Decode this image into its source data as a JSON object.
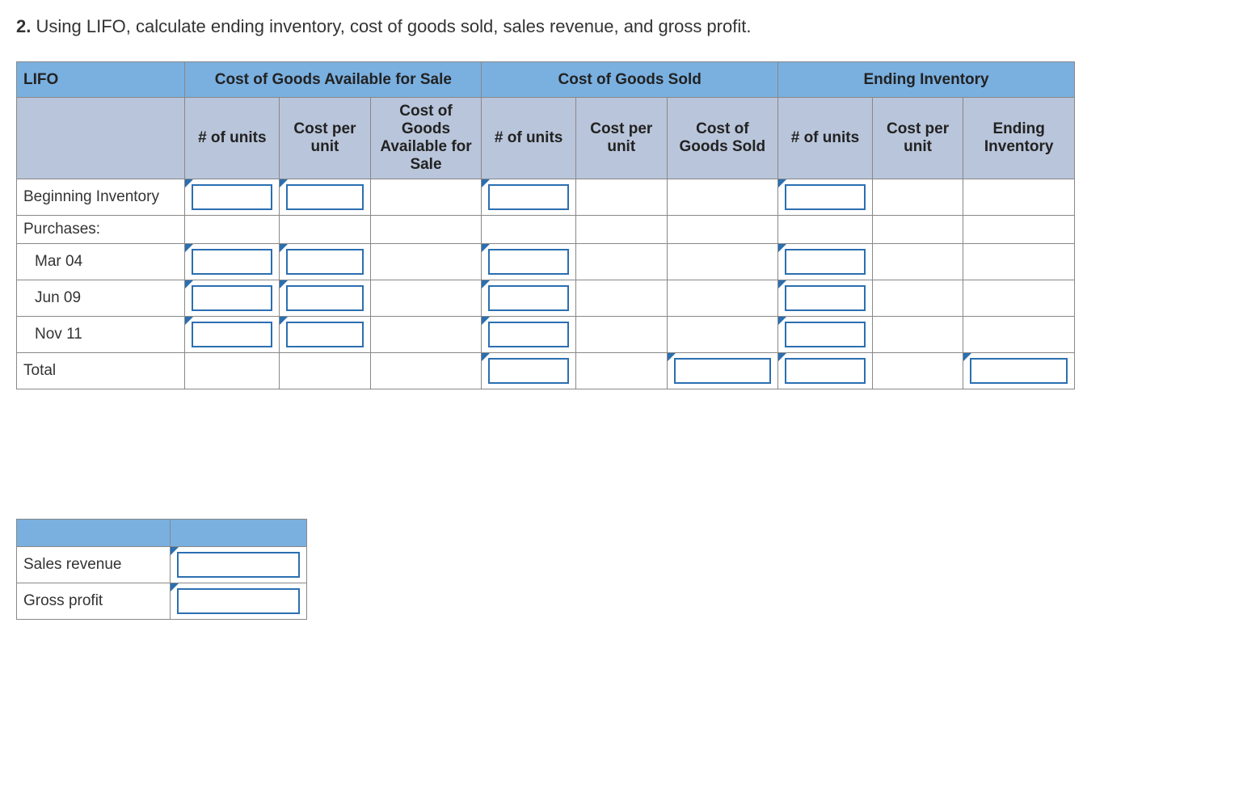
{
  "question": {
    "number": "2.",
    "text": "Using LIFO, calculate ending inventory, cost of goods sold, sales revenue, and gross profit."
  },
  "table": {
    "top_left": "LIFO",
    "group_headers": [
      "Cost of Goods Available for Sale",
      "Cost of Goods Sold",
      "Ending Inventory"
    ],
    "sub_headers": {
      "avail": [
        "# of units",
        "Cost per unit",
        "Cost of Goods Available for Sale"
      ],
      "sold": [
        "# of units",
        "Cost per unit",
        "Cost of Goods Sold"
      ],
      "ending": [
        "# of units",
        "Cost per unit",
        "Ending Inventory"
      ]
    },
    "rows": [
      {
        "label": "Beginning Inventory",
        "indent": false
      },
      {
        "label": "Purchases:",
        "indent": false
      },
      {
        "label": "Mar 04",
        "indent": true
      },
      {
        "label": "Jun 09",
        "indent": true
      },
      {
        "label": "Nov 11",
        "indent": true
      },
      {
        "label": "Total",
        "indent": false
      }
    ]
  },
  "summary": {
    "rows": [
      "Sales revenue",
      "Gross profit"
    ]
  }
}
